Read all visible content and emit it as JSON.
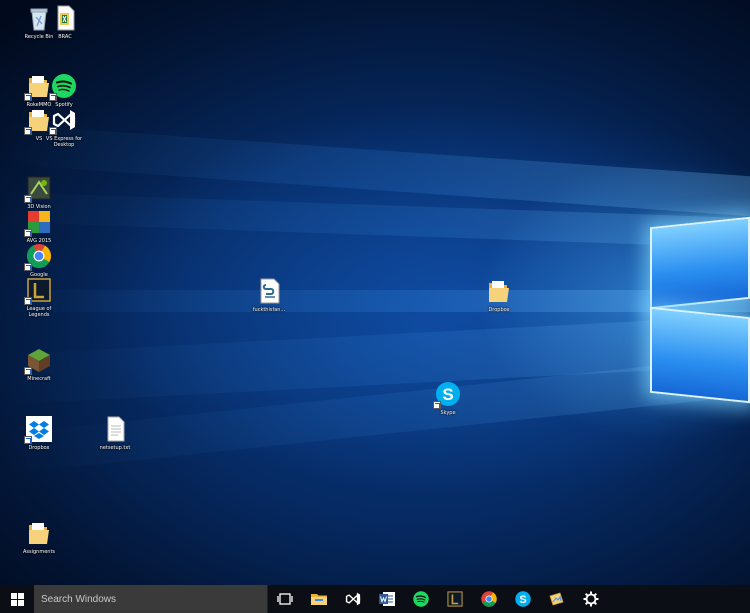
{
  "desktop": {
    "icons": [
      {
        "label": "Recycle Bin",
        "icon": "recycle-bin-icon",
        "shortcut": false
      },
      {
        "label": "BRAC",
        "icon": "excel-file-icon",
        "shortcut": false
      },
      {
        "label": "RokeMMO",
        "icon": "folder-icon",
        "shortcut": true
      },
      {
        "label": "Spotify",
        "icon": "spotify-icon",
        "shortcut": true
      },
      {
        "label": "VS",
        "icon": "folder-icon",
        "shortcut": true
      },
      {
        "label": "VS Express for Desktop",
        "icon": "visual-studio-icon",
        "shortcut": true
      },
      {
        "label": "3D Vision",
        "icon": "3d-vision-icon",
        "shortcut": true
      },
      {
        "label": "AVG 2015",
        "icon": "avg-icon",
        "shortcut": true
      },
      {
        "label": "Google",
        "icon": "chrome-icon",
        "shortcut": true
      },
      {
        "label": "League of Legends",
        "icon": "league-of-legends-icon",
        "shortcut": true
      },
      {
        "label": "Minecraft",
        "icon": "minecraft-icon",
        "shortcut": true
      },
      {
        "label": "Dropbox",
        "icon": "dropbox-icon",
        "shortcut": true
      },
      {
        "label": "netsetup.txt",
        "icon": "text-file-icon",
        "shortcut": false
      },
      {
        "label": "Assignments",
        "icon": "folder-icon",
        "shortcut": false
      },
      {
        "label": "fuckthisfan...",
        "icon": "script-file-icon",
        "shortcut": false
      },
      {
        "label": "Dropbox",
        "icon": "folder-icon",
        "shortcut": false
      },
      {
        "label": "Skype",
        "icon": "skype-icon",
        "shortcut": true
      }
    ]
  },
  "taskbar": {
    "search_placeholder": "Search Windows",
    "items": [
      {
        "name": "task-view",
        "icon": "task-view-icon"
      },
      {
        "name": "file-explorer",
        "icon": "file-explorer-icon"
      },
      {
        "name": "visual-studio",
        "icon": "visual-studio-icon"
      },
      {
        "name": "word",
        "icon": "word-icon"
      },
      {
        "name": "spotify",
        "icon": "spotify-icon"
      },
      {
        "name": "league-of-legends",
        "icon": "league-of-legends-icon"
      },
      {
        "name": "chrome",
        "icon": "chrome-icon"
      },
      {
        "name": "skype",
        "icon": "skype-icon"
      },
      {
        "name": "photos",
        "icon": "photos-icon"
      },
      {
        "name": "settings",
        "icon": "gear-icon"
      }
    ]
  },
  "colors": {
    "wallpaper_dark": "#021432",
    "wallpaper_glow": "#2a8ef0",
    "taskbar": "#0b0f15",
    "search_box": "#3a3a3a"
  }
}
